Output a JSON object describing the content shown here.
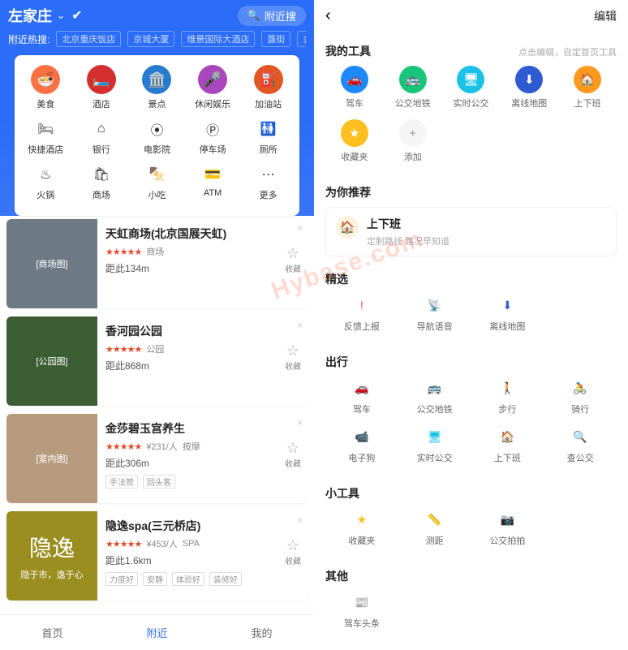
{
  "left": {
    "title": "左家庄",
    "search_pill": "附近搜",
    "hot_label": "附近热搜:",
    "hot_chips": [
      "北京重庆饭店",
      "京城大厦",
      "维景国际大酒店",
      "簋街",
      "金鼎轩南北家乡菜"
    ],
    "cat_row1": [
      {
        "label": "美食",
        "glyph": "🍜",
        "bg": "#ff7043"
      },
      {
        "label": "酒店",
        "glyph": "🛏️",
        "bg": "#d32f2f"
      },
      {
        "label": "景点",
        "glyph": "🏛️",
        "bg": "#277bd1"
      },
      {
        "label": "休闲娱乐",
        "glyph": "🎤",
        "bg": "#ab47bc"
      },
      {
        "label": "加油站",
        "glyph": "⛽",
        "bg": "#e25822"
      }
    ],
    "cat_row2": [
      {
        "label": "快捷酒店",
        "glyph": "🛏"
      },
      {
        "label": "银行",
        "glyph": "⌂"
      },
      {
        "label": "电影院",
        "glyph": "⦿"
      },
      {
        "label": "停车场",
        "glyph": "Ⓟ"
      },
      {
        "label": "厕所",
        "glyph": "🚻"
      }
    ],
    "cat_row3": [
      {
        "label": "火锅",
        "glyph": "♨"
      },
      {
        "label": "商场",
        "glyph": "🛍"
      },
      {
        "label": "小吃",
        "glyph": "🍢"
      },
      {
        "label": "ATM",
        "glyph": "💳"
      },
      {
        "label": "更多",
        "glyph": "⋯"
      }
    ],
    "places": [
      {
        "title": "天虹商场(北京国展天虹)",
        "cat": "商场",
        "dist": "距此134m",
        "tags": [],
        "img_label": "[商场图]",
        "img_bg": "#6d7a86"
      },
      {
        "title": "香河园公园",
        "cat": "公园",
        "dist": "距此868m",
        "tags": [],
        "img_label": "[公园图]",
        "img_bg": "#3c5e34"
      },
      {
        "title": "金莎碧玉宫养生",
        "cat": "按摩",
        "price": "¥231/人",
        "dist": "距此306m",
        "tags": [
          "手法赞",
          "回头客"
        ],
        "img_label": "[室内图]",
        "img_bg": "#b79a7d"
      },
      {
        "title": "隐逸spa(三元桥店)",
        "cat": "SPA",
        "price": "¥453/人",
        "dist": "距此1.6km",
        "tags": [
          "力度好",
          "安静",
          "体验好",
          "装修好"
        ],
        "img_label": "隐逸",
        "img_bg": "#9a8e20",
        "yinyi": true
      }
    ],
    "fav_label": "收藏",
    "yinyi_sub": "隐于市，逸于心",
    "tabs": [
      {
        "label": "首页"
      },
      {
        "label": "附近",
        "active": true
      },
      {
        "label": "我的"
      }
    ]
  },
  "right": {
    "edit": "编辑",
    "my_tools": {
      "title": "我的工具",
      "hint": "点击编辑，自定首页工具"
    },
    "tools": [
      {
        "label": "驾车",
        "glyph": "🚗",
        "cls": "icon-blue"
      },
      {
        "label": "公交地铁",
        "glyph": "🚌",
        "cls": "icon-green"
      },
      {
        "label": "实时公交",
        "glyph": "🖥",
        "cls": "icon-cyan"
      },
      {
        "label": "离线地图",
        "glyph": "⬇",
        "cls": "icon-navy"
      },
      {
        "label": "上下班",
        "glyph": "🏠",
        "cls": "icon-orange"
      },
      {
        "label": "收藏夹",
        "glyph": "★",
        "cls": "icon-yellow"
      },
      {
        "label": "添加",
        "glyph": "+",
        "cls": "icon-plain"
      }
    ],
    "recommend": {
      "title": "为你推荐",
      "card_title": "上下班",
      "card_sub": "定制路线 路况早知道"
    },
    "featured": {
      "title": "精选",
      "items": [
        {
          "label": "反馈上报",
          "glyph": "!",
          "color": "c-red"
        },
        {
          "label": "导航语音",
          "glyph": "📡",
          "color": "c-blue"
        },
        {
          "label": "离线地图",
          "glyph": "⬇",
          "color": "c-navy"
        }
      ]
    },
    "travel": {
      "title": "出行",
      "items": [
        {
          "label": "驾车",
          "glyph": "🚗",
          "color": "c-blue"
        },
        {
          "label": "公交地铁",
          "glyph": "🚌",
          "color": "c-green"
        },
        {
          "label": "步行",
          "glyph": "🚶",
          "color": "c-orange"
        },
        {
          "label": "骑行",
          "glyph": "🚴",
          "color": "c-green"
        },
        {
          "label": "电子狗",
          "glyph": "📹",
          "color": "c-blue"
        },
        {
          "label": "实时公交",
          "glyph": "🖥",
          "color": "c-cyan"
        },
        {
          "label": "上下班",
          "glyph": "🏠",
          "color": "c-orange"
        },
        {
          "label": "查公交",
          "glyph": "🔍",
          "color": "c-green"
        }
      ]
    },
    "widgets": {
      "title": "小工具",
      "items": [
        {
          "label": "收藏夹",
          "glyph": "★",
          "color": "c-yellow"
        },
        {
          "label": "测距",
          "glyph": "📏",
          "color": "c-orange"
        },
        {
          "label": "公交拍拍",
          "glyph": "📷",
          "color": "c-blue"
        }
      ]
    },
    "other": {
      "title": "其他",
      "items": [
        {
          "label": "驾车头条",
          "glyph": "📰",
          "color": "c-purple"
        }
      ]
    }
  },
  "watermark": "Hybase.com"
}
